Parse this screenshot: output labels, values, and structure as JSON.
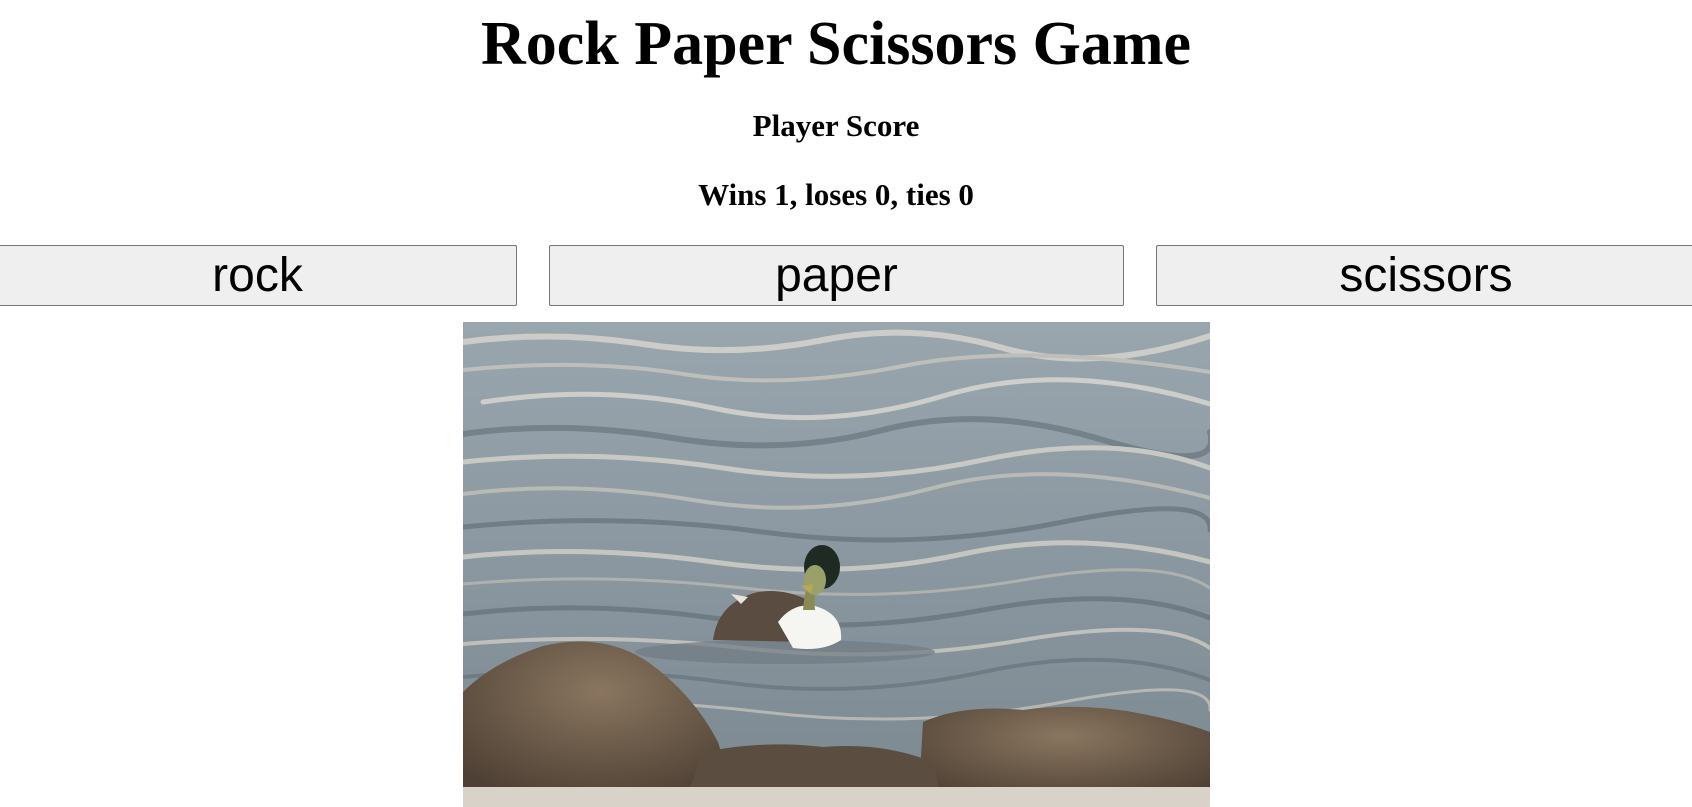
{
  "header": {
    "title": "Rock Paper Scissors Game",
    "subtitle": "Player Score",
    "score_text": "Wins 1, loses 0, ties 0"
  },
  "score": {
    "wins": 1,
    "loses": 0,
    "ties": 0
  },
  "choices": {
    "rock_label": "rock",
    "paper_label": "paper",
    "scissors_label": "scissors"
  },
  "result_image": {
    "alt": "duck-on-water-photo",
    "colors": {
      "water": "#8e9aa3",
      "seaweed": "#6b5a45",
      "sand": "#d8d2c8"
    }
  }
}
